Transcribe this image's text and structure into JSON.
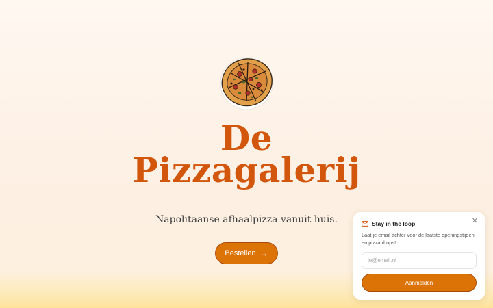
{
  "hero": {
    "title_line1": "De",
    "title_line2": "Pizzagalerij",
    "subtitle": "Napolitaanse afhaalpizza vanuit huis.",
    "order_button": "Bestellen"
  },
  "newsletter": {
    "title": "Stay in the loop",
    "text": "Laat je email achter voor de laatste openingstijden en pizza drops!",
    "email_placeholder": "je@email.nl",
    "email_value": "",
    "submit_label": "Aanmelden"
  },
  "colors": {
    "accent": "#db7307",
    "title": "#d2560b"
  }
}
